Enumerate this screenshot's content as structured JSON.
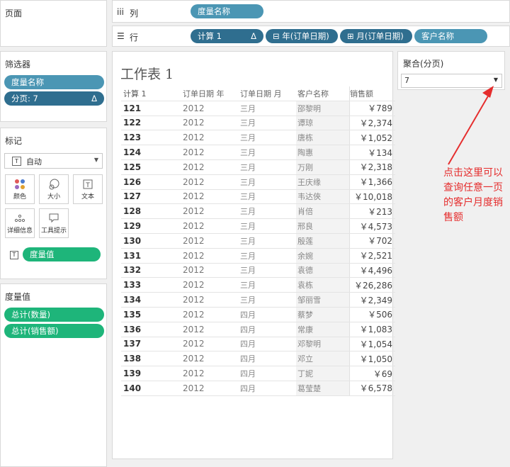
{
  "pages_panel": {
    "title": "页面"
  },
  "filters_panel": {
    "title": "筛选器",
    "items": [
      "度量名称",
      "分页: 7"
    ],
    "delta": "Δ"
  },
  "marks_panel": {
    "title": "标记",
    "mark_type": "自动",
    "buttons": [
      "颜色",
      "大小",
      "文本",
      "详细信息",
      "工具提示"
    ],
    "field": "度量值"
  },
  "measures_panel": {
    "title": "度量值",
    "items": [
      "总计(数量)",
      "总计(销售额)"
    ]
  },
  "columns_shelf": {
    "label": "列",
    "pills": [
      "度量名称"
    ]
  },
  "rows_shelf": {
    "label": "行",
    "pills": [
      "计算 1",
      "年(订单日期)",
      "月(订单日期)",
      "客户名称"
    ],
    "delta": "Δ"
  },
  "worksheet": {
    "title": "工作表 1",
    "headers": [
      "计算 1",
      "订单日期 年",
      "订单日期 月",
      "客户名称",
      "销售额"
    ],
    "rows": [
      [
        "121",
        "2012",
        "三月",
        "邵黎明",
        "￥789"
      ],
      [
        "122",
        "2012",
        "三月",
        "谭琼",
        "￥2,374"
      ],
      [
        "123",
        "2012",
        "三月",
        "唐栋",
        "￥1,052"
      ],
      [
        "124",
        "2012",
        "三月",
        "陶惠",
        "￥134"
      ],
      [
        "125",
        "2012",
        "三月",
        "万刚",
        "￥2,318"
      ],
      [
        "126",
        "2012",
        "三月",
        "王庆缘",
        "￥1,366"
      ],
      [
        "127",
        "2012",
        "三月",
        "韦达俠",
        "￥10,018"
      ],
      [
        "128",
        "2012",
        "三月",
        "肖倍",
        "￥213"
      ],
      [
        "129",
        "2012",
        "三月",
        "邢良",
        "￥4,573"
      ],
      [
        "130",
        "2012",
        "三月",
        "殷莲",
        "￥702"
      ],
      [
        "131",
        "2012",
        "三月",
        "余婉",
        "￥2,521"
      ],
      [
        "132",
        "2012",
        "三月",
        "袁德",
        "￥4,496"
      ],
      [
        "133",
        "2012",
        "三月",
        "袁栋",
        "￥26,286"
      ],
      [
        "134",
        "2012",
        "三月",
        "邹丽雪",
        "￥2,349"
      ],
      [
        "135",
        "2012",
        "四月",
        "蔡梦",
        "￥506"
      ],
      [
        "136",
        "2012",
        "四月",
        "常康",
        "￥1,083"
      ],
      [
        "137",
        "2012",
        "四月",
        "邓黎明",
        "￥1,054"
      ],
      [
        "138",
        "2012",
        "四月",
        "邓立",
        "￥1,050"
      ],
      [
        "139",
        "2012",
        "四月",
        "丁妮",
        "￥69"
      ],
      [
        "140",
        "2012",
        "四月",
        "葛莹楚",
        "￥6,578"
      ]
    ]
  },
  "aggregate_panel": {
    "title": "聚合(分页)",
    "value": "7"
  },
  "annotation": {
    "text": "点击这里可以查询任意一页的客户月度销售额",
    "color": "#e52d2d"
  }
}
